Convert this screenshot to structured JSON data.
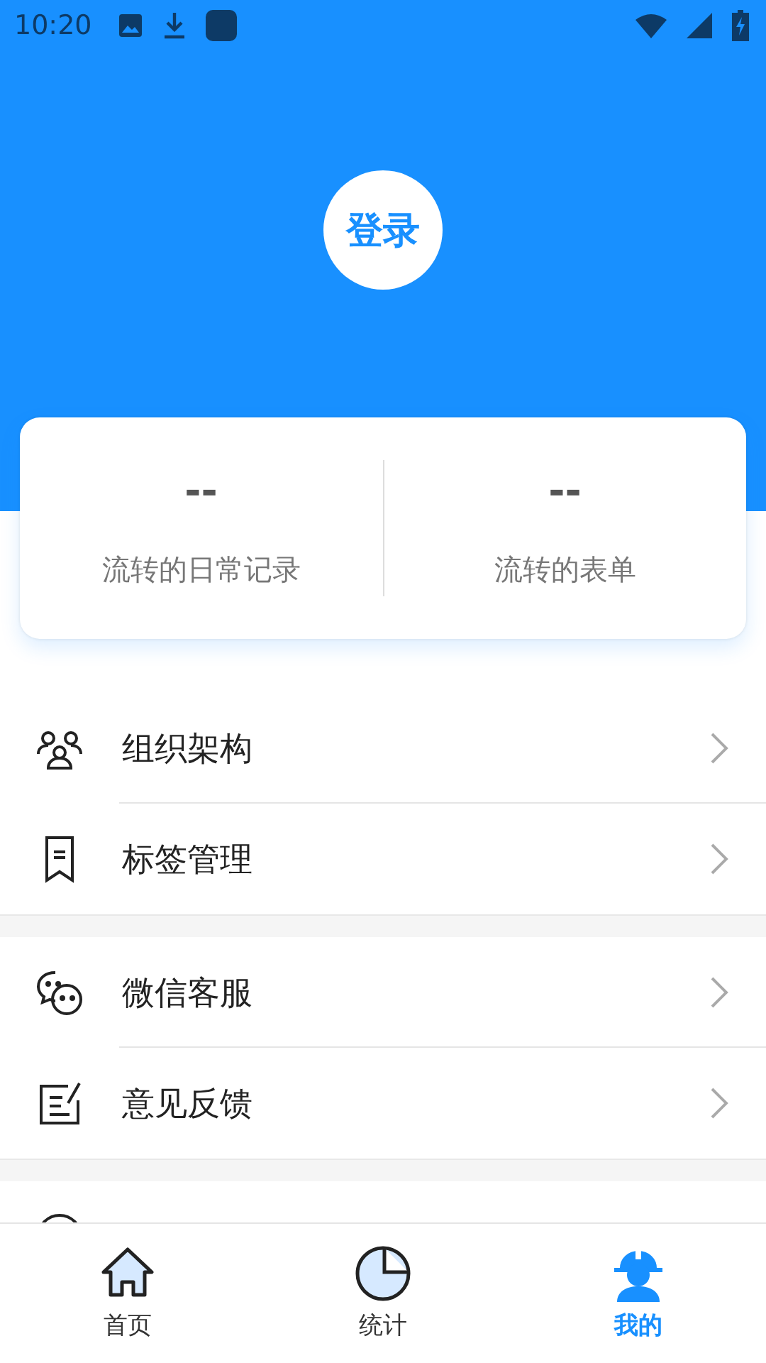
{
  "status_bar": {
    "time": "10:20"
  },
  "login": {
    "label": "登录"
  },
  "stats": [
    {
      "value": "--",
      "label": "流转的日常记录"
    },
    {
      "value": "--",
      "label": "流转的表单"
    }
  ],
  "menu_groups": [
    {
      "items": [
        {
          "kind": "org",
          "label": "组织架构"
        },
        {
          "kind": "tag",
          "label": "标签管理"
        }
      ]
    },
    {
      "items": [
        {
          "kind": "chat",
          "label": "微信客服"
        },
        {
          "kind": "feedback",
          "label": "意见反馈"
        }
      ]
    },
    {
      "items": [
        {
          "kind": "info"
        }
      ]
    }
  ],
  "tabs": [
    {
      "kind": "home",
      "label": "首页",
      "selected": false
    },
    {
      "kind": "stats",
      "label": "统计",
      "selected": false
    },
    {
      "kind": "mine",
      "label": "我的",
      "selected": true
    }
  ]
}
